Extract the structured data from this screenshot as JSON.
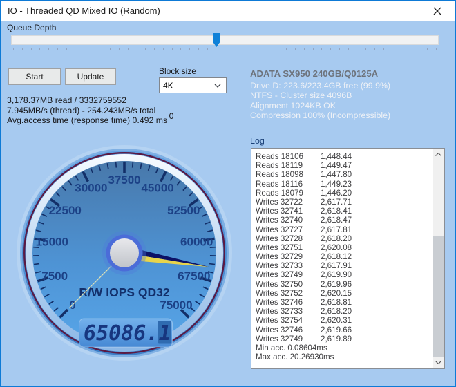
{
  "window": {
    "title": "IO - Threaded QD Mixed IO (Random)"
  },
  "icons": {
    "close": "close-x",
    "block_size_dropdown": "chevron-down",
    "log_scroll_up": "chevron-up",
    "log_scroll_down": "chevron-down"
  },
  "queue_depth": {
    "label": "Queue Depth",
    "fraction": 0.48,
    "tick_count": 49
  },
  "controls": {
    "start_label": "Start",
    "update_label": "Update",
    "block_size_label": "Block size",
    "block_size_value": "4K",
    "threads_value": "0"
  },
  "stats": {
    "line1": "3,178.37MB read / 3332759552",
    "line2": "7.945MB/s (thread) - 254.243MB/s total",
    "line3": "Avg.access time (response time) 0.492 ms"
  },
  "drive": {
    "model": "ADATA SX950 240GB/Q0125A",
    "lines": [
      "Drive D: 223.6/223.4GB free (99.9%)",
      "NTFS - Cluster size 4096B",
      "Alignment 1024KB OK",
      "Compression 100% (Incompressible)"
    ]
  },
  "log": {
    "label": "Log",
    "entries": [
      [
        "Reads 18106",
        "1,448.44"
      ],
      [
        "Reads 18119",
        "1,449.47"
      ],
      [
        "Reads 18098",
        "1,447.80"
      ],
      [
        "Reads 18116",
        "1,449.23"
      ],
      [
        "Reads 18079",
        "1,446.20"
      ],
      [
        "Writes 32722",
        "2,617.71"
      ],
      [
        "Writes 32741",
        "2,618.41"
      ],
      [
        "Writes 32740",
        "2,618.47"
      ],
      [
        "Writes 32727",
        "2,617.81"
      ],
      [
        "Writes 32728",
        "2,618.20"
      ],
      [
        "Writes 32751",
        "2,620.08"
      ],
      [
        "Writes 32729",
        "2,618.12"
      ],
      [
        "Writes 32733",
        "2,617.91"
      ],
      [
        "Writes 32749",
        "2,619.90"
      ],
      [
        "Writes 32750",
        "2,619.96"
      ],
      [
        "Writes 32752",
        "2,620.15"
      ],
      [
        "Writes 32746",
        "2,618.81"
      ],
      [
        "Writes 32733",
        "2,618.20"
      ],
      [
        "Writes 32754",
        "2,620.31"
      ],
      [
        "Writes 32746",
        "2,619.66"
      ],
      [
        "Writes 32749",
        "2,619.89"
      ]
    ],
    "footers": [
      "Min acc. 0.08604ms",
      "Max acc. 20.26930ms"
    ]
  },
  "chart_data": {
    "type": "gauge",
    "title": "R/W IOPS QD32",
    "min": 0,
    "max": 75000,
    "minor_tick_step": 1500,
    "major_tick_step": 7500,
    "tick_labels": [
      "0",
      "7500",
      "15000",
      "22500",
      "30000",
      "37500",
      "45000",
      "52500",
      "60000",
      "67500",
      "75000"
    ],
    "start_angle": -135,
    "end_angle": 135,
    "value": 65086.1,
    "display_value": "65086.1",
    "tail_value": 0,
    "colors": {
      "glow_outer": "#b5d3f2",
      "glow_inner": "#7fb0e4",
      "ring_top": "#61a0e0",
      "ring_bottom": "#3d7ec6",
      "bezel_maroon": "#5a1a44",
      "light_ring_top": "#f6fbff",
      "light_ring_bottom": "#8ab6e6",
      "face_top": "#4878aa",
      "face_mid": "#4e93d4",
      "face_bottom": "#57a5e8",
      "tick": "#132f68",
      "label": "#1c4186",
      "needle_dark": "#0c1166",
      "needle_light": "#e8d44a",
      "tail": "#f0ebb4",
      "hub_glow": "#4e7cda",
      "hub_ring": "#4b6cd8",
      "hub_top": "#e8e8ec",
      "hub_bottom": "#c0c4ca",
      "panel_top": "#74b2ec",
      "panel_bottom": "#4689d4",
      "panel_dark_cell": "#2f6bb0",
      "digit": "#17367f"
    }
  },
  "colors": {
    "accent": "#0e7ad6",
    "background": "#a7caf0",
    "titlebar": "#ffffff"
  }
}
